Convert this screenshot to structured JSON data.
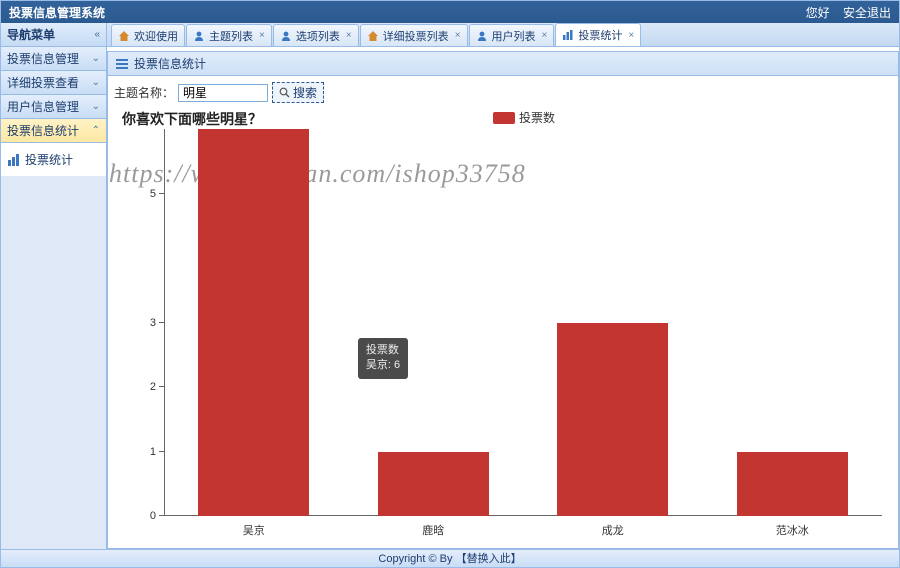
{
  "app_title": "投票信息管理系统",
  "topbar_links": {
    "hello": "您好",
    "logout": "安全退出"
  },
  "sidebar": {
    "header": "导航菜单",
    "items": [
      {
        "label": "投票信息管理"
      },
      {
        "label": "详细投票查看"
      },
      {
        "label": "用户信息管理"
      },
      {
        "label": "投票信息统计"
      }
    ],
    "leaf": "投票统计"
  },
  "tabs": [
    {
      "label": "欢迎使用",
      "icon": "home",
      "closable": false
    },
    {
      "label": "主题列表",
      "icon": "user",
      "closable": true
    },
    {
      "label": "选项列表",
      "icon": "user",
      "closable": true
    },
    {
      "label": "详细投票列表",
      "icon": "home",
      "closable": true
    },
    {
      "label": "用户列表",
      "icon": "user",
      "closable": true
    },
    {
      "label": "投票统计",
      "icon": "chart",
      "closable": true,
      "active": true
    }
  ],
  "panel_title": "投票信息统计",
  "search": {
    "label": "主题名称：",
    "value": "明星",
    "button": "搜索"
  },
  "chart_data": {
    "type": "bar",
    "title": "你喜欢下面哪些明星？",
    "series_name": "投票数",
    "categories": [
      "吴京",
      "鹿晗",
      "成龙",
      "范冰冰"
    ],
    "values": [
      6,
      1,
      3,
      1
    ],
    "ylim": [
      0,
      6
    ],
    "yticks": [
      0,
      1,
      2,
      3,
      5
    ],
    "xlabel": "",
    "ylabel": ""
  },
  "tooltip": {
    "line1": "投票数",
    "line2": "吴京: 6"
  },
  "watermark": "https://www.huzhan.com/ishop33758",
  "footer": "Copyright © By 【替换入此】"
}
